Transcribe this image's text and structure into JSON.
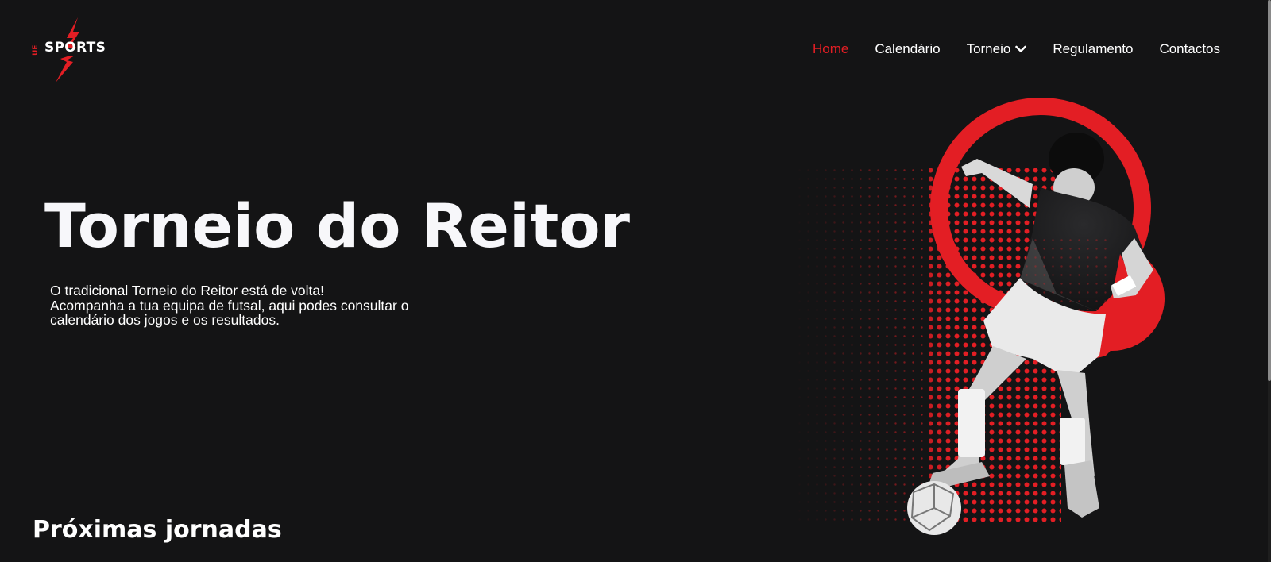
{
  "brand": {
    "name": "SPORTS",
    "prefix": "UE",
    "accent": "#e31e24"
  },
  "nav": {
    "items": [
      {
        "label": "Home",
        "active": true
      },
      {
        "label": "Calendário",
        "active": false
      },
      {
        "label": "Torneio",
        "active": false,
        "dropdown": true
      },
      {
        "label": "Regulamento",
        "active": false
      },
      {
        "label": "Contactos",
        "active": false
      }
    ]
  },
  "hero": {
    "title": "Torneio do Reitor",
    "description": [
      "O tradicional Torneio do Reitor está de volta!",
      "Acompanha a tua equipa de futsal, aqui podes consultar o",
      "calendário dos jogos e os resultados."
    ]
  },
  "section": {
    "title": "Próximas jornadas"
  },
  "colors": {
    "background": "#141415",
    "accent": "#e31e24",
    "text": "#ffffff"
  }
}
